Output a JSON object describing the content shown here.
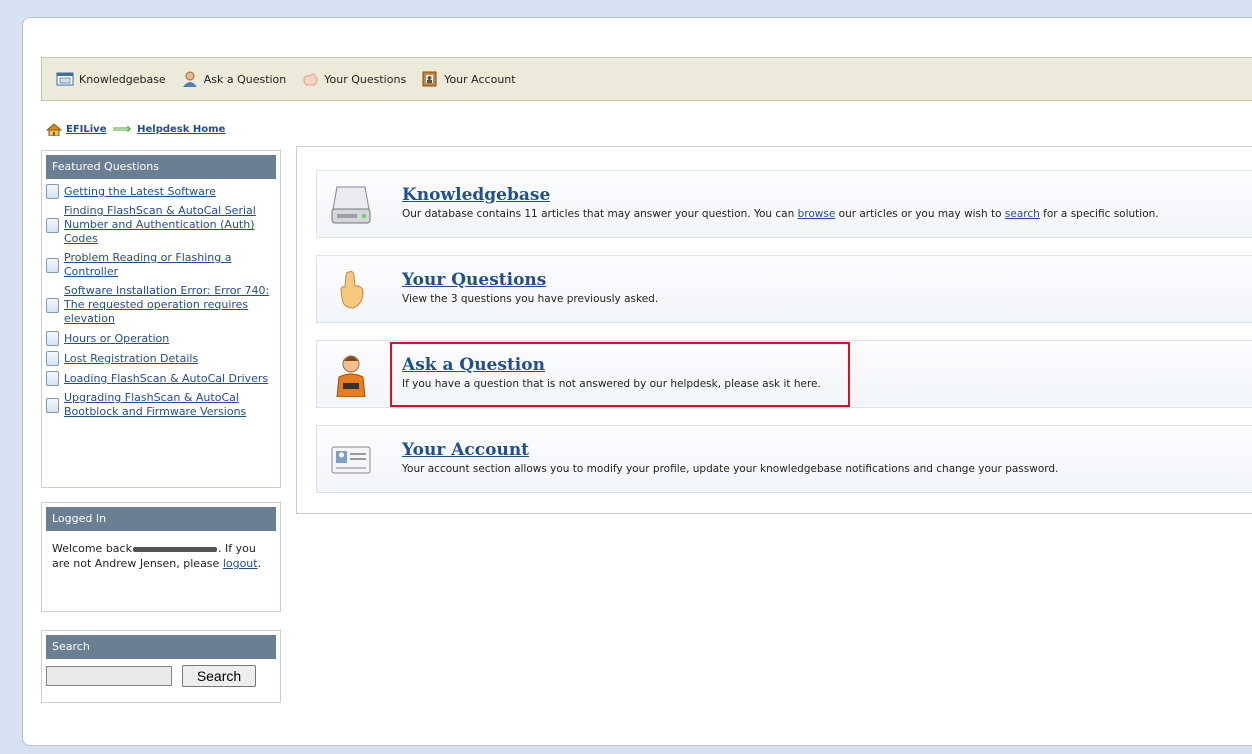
{
  "toolbar": {
    "items": [
      {
        "label": "Knowledgebase",
        "icon": "window-icon"
      },
      {
        "label": "Ask a Question",
        "icon": "person-icon"
      },
      {
        "label": "Your Questions",
        "icon": "hand-icon"
      },
      {
        "label": "Your Account",
        "icon": "account-card-icon"
      }
    ]
  },
  "breadcrumb": {
    "home": "EFILive",
    "current": "Helpdesk Home"
  },
  "featured": {
    "title": "Featured Questions",
    "items": [
      "Getting the Latest Software",
      "Finding FlashScan & AutoCal Serial Number and Authentication (Auth) Codes",
      "Problem Reading or Flashing a Controller",
      "Software Installation Error: Error 740: The requested operation requires elevation",
      "Hours or Operation",
      "Lost Registration Details",
      "Loading FlashScan & AutoCal Drivers",
      "Upgrading FlashScan & AutoCal Bootblock and Firmware Versions"
    ]
  },
  "logged_in": {
    "title": "Logged In",
    "welcome": "Welcome back",
    "after_name": ". If you are not Andrew Jensen, please",
    "logout": "logout",
    "end": "."
  },
  "search": {
    "title": "Search",
    "button": "Search",
    "value": ""
  },
  "cards": [
    {
      "title": "Knowledgebase",
      "desc_pre": "Our database contains 11 articles that may answer your question. You can",
      "link1": "browse",
      "desc_mid": "our articles or you may wish to",
      "link2": "search",
      "desc_post": "for a specific solution."
    },
    {
      "title": "Your Questions",
      "desc": "View the 3 questions you have previously asked."
    },
    {
      "title": "Ask a Question",
      "desc": "If you have a question that is not answered by our helpdesk, please ask it here."
    },
    {
      "title": "Your Account",
      "desc": "Your account section allows you to modify your profile, update your knowledgebase notifications and change your password."
    }
  ],
  "colors": {
    "link": "#1f4f8f",
    "panel_header": "#6b7f92",
    "toolbar_bg": "#ecebd9",
    "highlight": "#d9131b"
  }
}
